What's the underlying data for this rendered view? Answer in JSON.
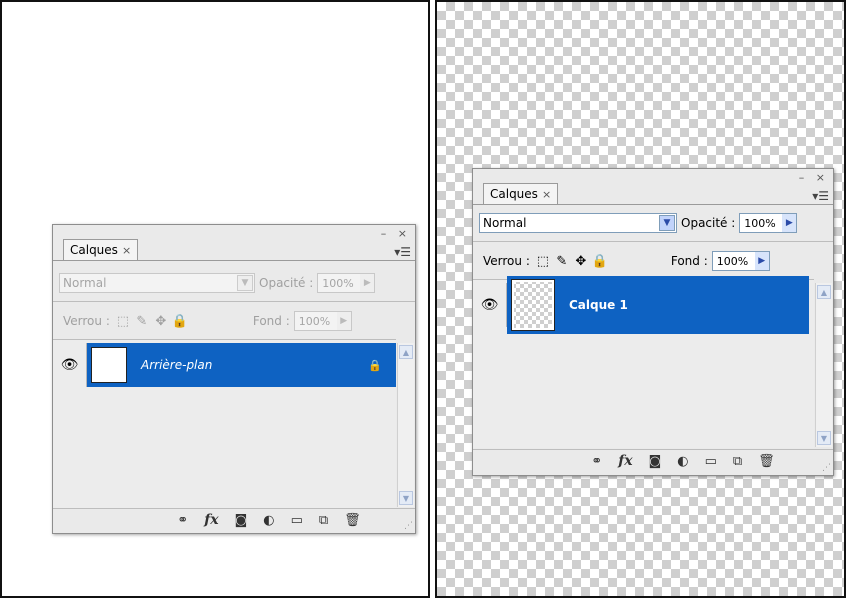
{
  "left_panel": {
    "tab_label": "Calques",
    "tab_close": "×",
    "window_controls": "– ×",
    "menu_icon": "▾☰",
    "blend_mode": "Normal",
    "opacity_label": "Opacité :",
    "opacity_value": "100%",
    "lock_label": "Verrou :",
    "fill_label": "Fond :",
    "fill_value": "100%",
    "layer": {
      "name": "Arrière-plan",
      "locked": true
    }
  },
  "right_panel": {
    "tab_label": "Calques",
    "tab_close": "×",
    "window_controls": "– ×",
    "menu_icon": "▾☰",
    "blend_mode": "Normal",
    "opacity_label": "Opacité :",
    "opacity_value": "100%",
    "lock_label": "Verrou :",
    "fill_label": "Fond :",
    "fill_value": "100%",
    "layer": {
      "name": "Calque 1",
      "locked": false
    }
  },
  "icons": {
    "eye": "👁",
    "lock_transparency": "⬚",
    "lock_paint": "✎",
    "lock_move": "✥",
    "lock_all": "🔒",
    "link": "⚭",
    "fx": "fx",
    "mask": "◙",
    "adjustment": "◐",
    "group": "▭",
    "new_layer": "⧉",
    "trash": "🗑",
    "dropdown": "▼",
    "spin": "▶"
  },
  "colors": {
    "selection": "#0e62c2",
    "panel": "#eaeaea"
  }
}
